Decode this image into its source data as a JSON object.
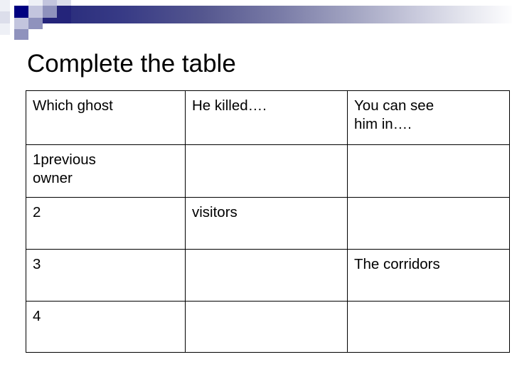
{
  "slide": {
    "title": "Complete the table",
    "decor": {
      "bar_gradient_from": "#2c2f7e",
      "bar_gradient_to": "#fdfdfe",
      "accent_dark": "#000080",
      "accent_navy": "#24247a",
      "accent_mid": "#8f92bd",
      "accent_light": "#c3c5de"
    }
  },
  "table": {
    "columns": [
      {
        "key": "ghost",
        "header_lines": [
          "Which ghost"
        ]
      },
      {
        "key": "killed",
        "header_lines": [
          "He killed…. "
        ]
      },
      {
        "key": "seen",
        "header_lines": [
          "You can see",
          "him in…. "
        ]
      }
    ],
    "rows": [
      {
        "name": "row-1",
        "cells": [
          {
            "lines": [
              "1previous",
              "owner"
            ]
          },
          {
            "lines": []
          },
          {
            "lines": []
          }
        ]
      },
      {
        "name": "row-2",
        "cells": [
          {
            "lines": [
              "2"
            ]
          },
          {
            "lines": [
              "visitors"
            ]
          },
          {
            "lines": []
          }
        ]
      },
      {
        "name": "row-3",
        "cells": [
          {
            "lines": [
              "3"
            ]
          },
          {
            "lines": []
          },
          {
            "lines": [
              "The corridors"
            ]
          }
        ]
      },
      {
        "name": "row-4",
        "cells": [
          {
            "lines": [
              "4"
            ]
          },
          {
            "lines": []
          },
          {
            "lines": []
          }
        ]
      }
    ]
  }
}
